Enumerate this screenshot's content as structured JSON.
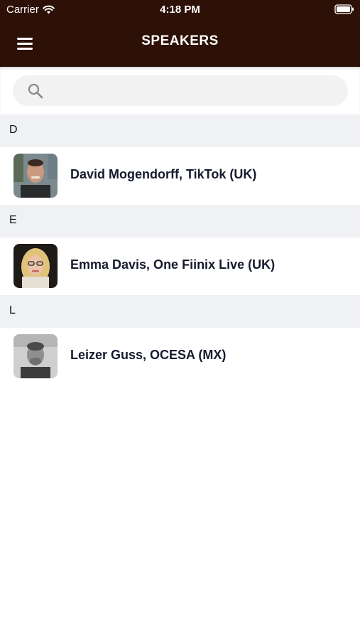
{
  "status_bar": {
    "carrier": "Carrier",
    "time": "4:18 PM"
  },
  "header": {
    "title": "SPEAKERS",
    "menu_icon": "hamburger-menu-icon"
  },
  "search": {
    "placeholder": "",
    "value": "",
    "icon": "search-icon"
  },
  "sections": [
    {
      "letter": "D",
      "speaker": "David Mogendorff, TikTok (UK)"
    },
    {
      "letter": "E",
      "speaker": "Emma Davis, One Fiinix Live (UK)"
    },
    {
      "letter": "L",
      "speaker": "Leizer Guss, OCESA (MX)"
    }
  ],
  "colors": {
    "header_bg": "#2e1106",
    "section_bg": "#eff1f4",
    "name_text": "#161a2e"
  }
}
